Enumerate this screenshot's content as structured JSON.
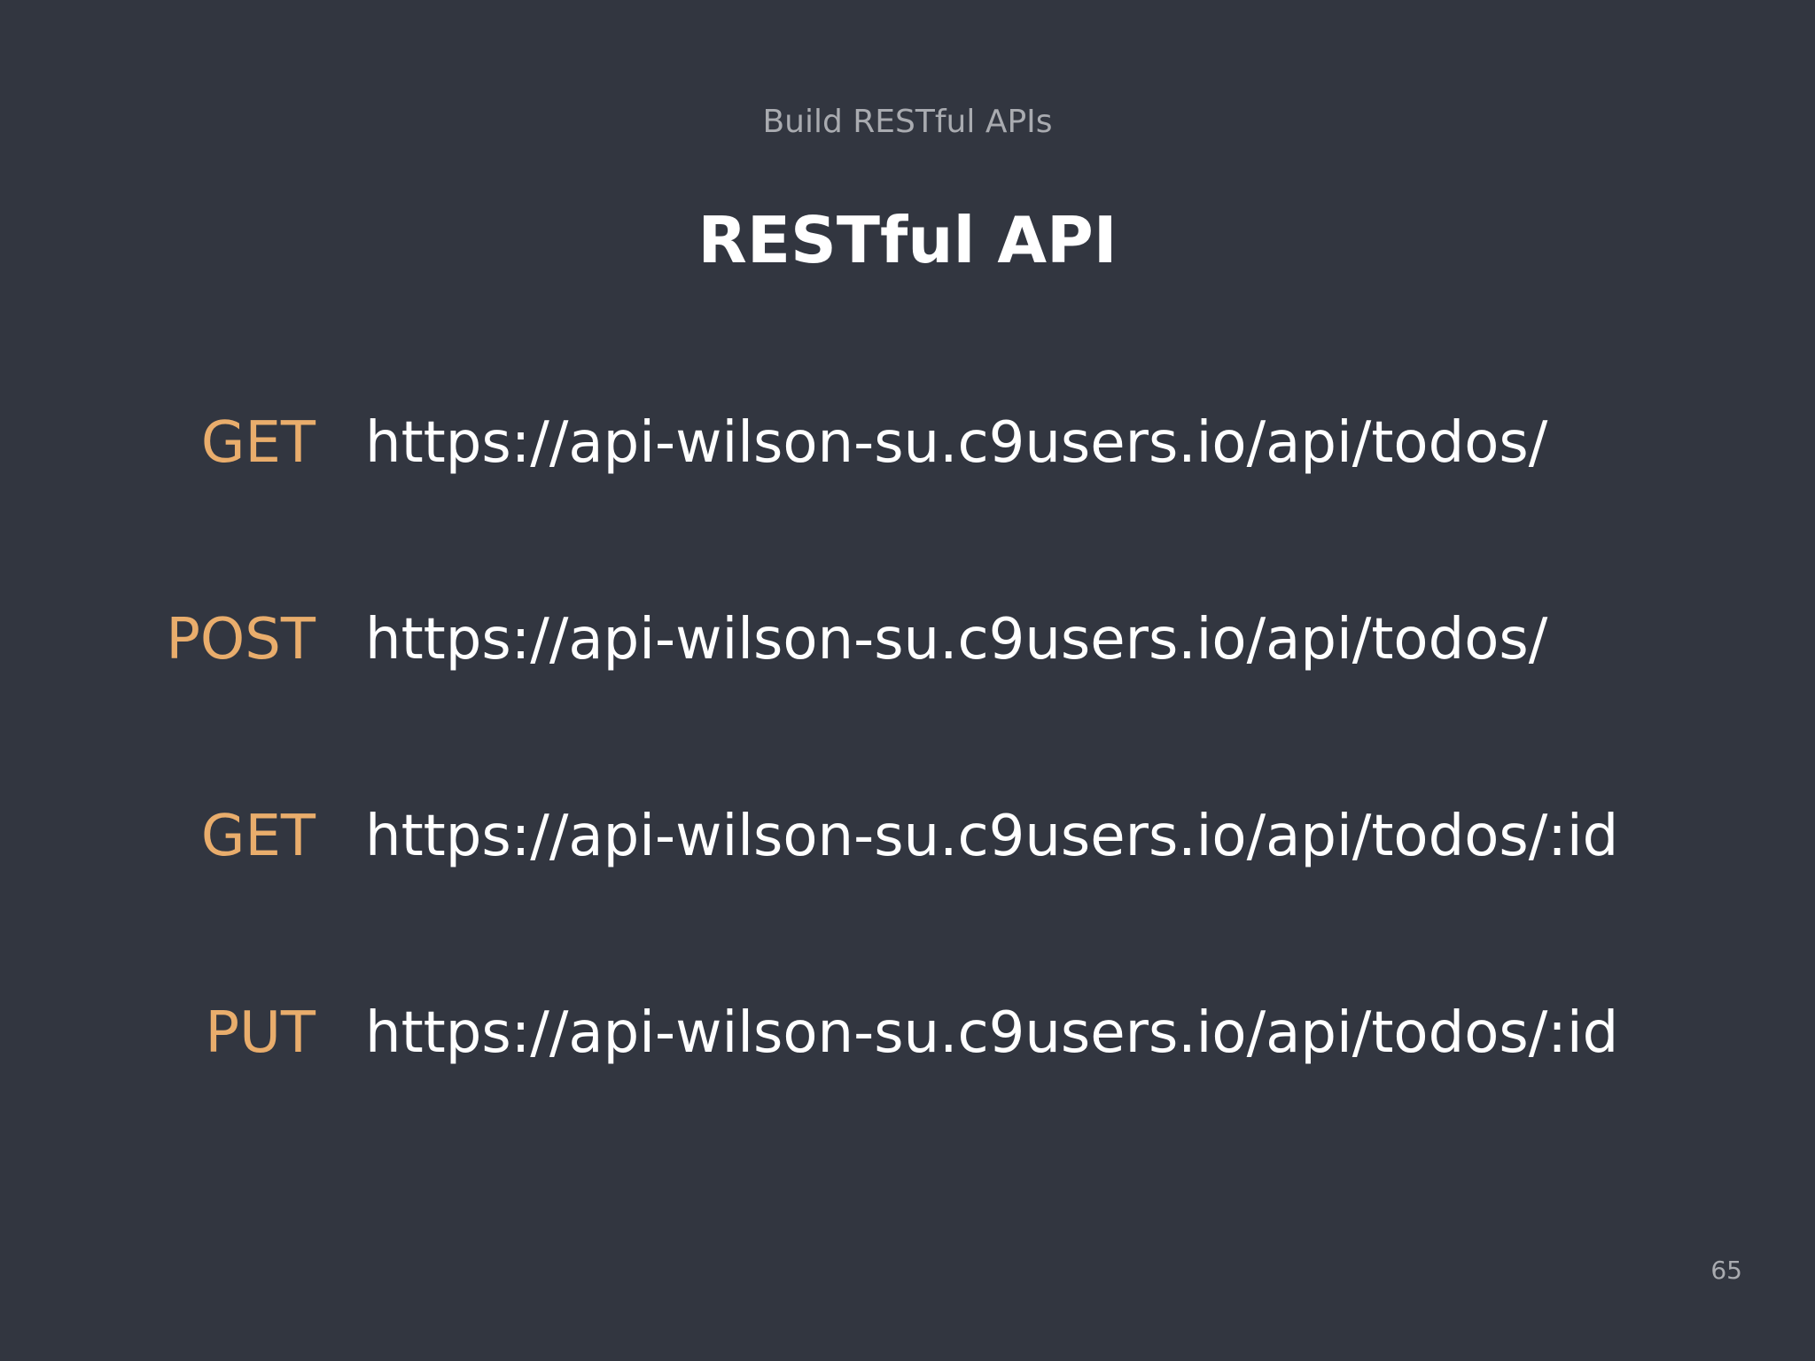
{
  "slide": {
    "subtitle": "Build RESTful APIs",
    "title": "RESTful API",
    "page_number": "65",
    "colors": {
      "background": "#323640",
      "method": "#e9ad6c",
      "url": "#ffffff",
      "muted": "#a9abb0"
    },
    "routes": [
      {
        "method": "GET",
        "url": "https://api-wilson-su.c9users.io/api/todos/"
      },
      {
        "method": "POST",
        "url": "https://api-wilson-su.c9users.io/api/todos/"
      },
      {
        "method": "GET",
        "url": "https://api-wilson-su.c9users.io/api/todos/:id"
      },
      {
        "method": "PUT",
        "url": "https://api-wilson-su.c9users.io/api/todos/:id"
      }
    ]
  }
}
